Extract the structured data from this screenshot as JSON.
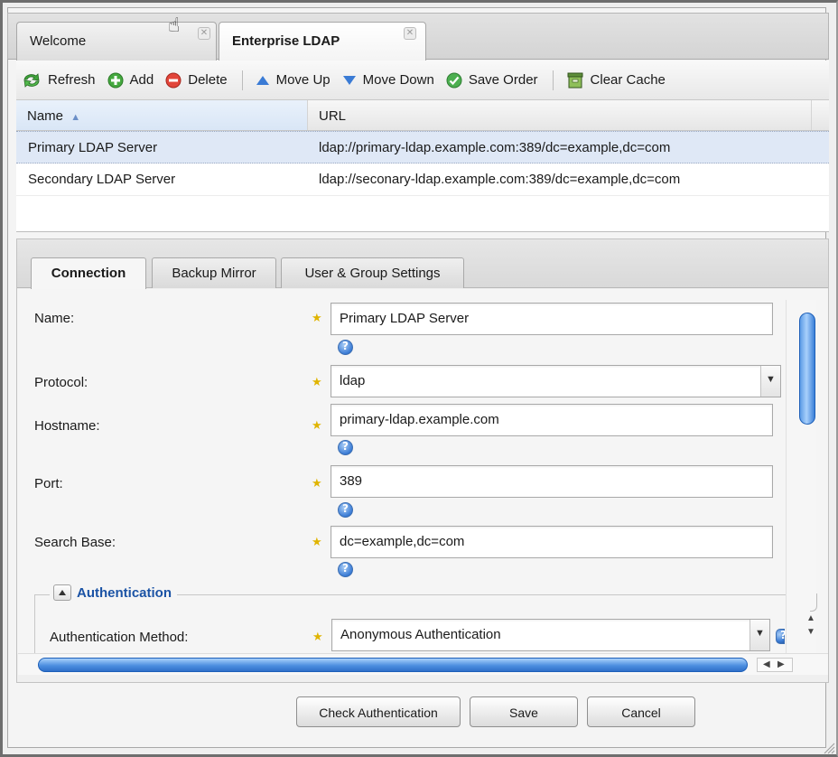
{
  "top_tabs": [
    {
      "label": "Welcome"
    },
    {
      "label": "Enterprise LDAP"
    }
  ],
  "toolbar": {
    "refresh": "Refresh",
    "add": "Add",
    "delete": "Delete",
    "move_up": "Move Up",
    "move_down": "Move Down",
    "save_order": "Save Order",
    "clear_cache": "Clear Cache"
  },
  "grid": {
    "columns": [
      "Name",
      "URL"
    ],
    "sort_indicator": "▲",
    "rows": [
      {
        "name": "Primary LDAP Server",
        "url": "ldap://primary-ldap.example.com:389/dc=example,dc=com"
      },
      {
        "name": "Secondary LDAP Server",
        "url": "ldap://seconary-ldap.example.com:389/dc=example,dc=com"
      }
    ]
  },
  "detail_tabs": [
    {
      "label": "Connection"
    },
    {
      "label": "Backup Mirror"
    },
    {
      "label": "User & Group Settings"
    }
  ],
  "form": {
    "name_label": "Name:",
    "name_value": "Primary LDAP Server",
    "protocol_label": "Protocol:",
    "protocol_value": "ldap",
    "hostname_label": "Hostname:",
    "hostname_value": "primary-ldap.example.com",
    "port_label": "Port:",
    "port_value": "389",
    "search_base_label": "Search Base:",
    "search_base_value": "dc=example,dc=com",
    "auth_section": "Authentication",
    "auth_method_label": "Authentication Method:",
    "auth_method_value": "Anonymous Authentication"
  },
  "buttons": {
    "check_auth": "Check Authentication",
    "save": "Save",
    "cancel": "Cancel"
  },
  "colors": {
    "accent": "#1b53a5",
    "selected_row": "#dfe8f6",
    "required_star": "#e0b400"
  }
}
